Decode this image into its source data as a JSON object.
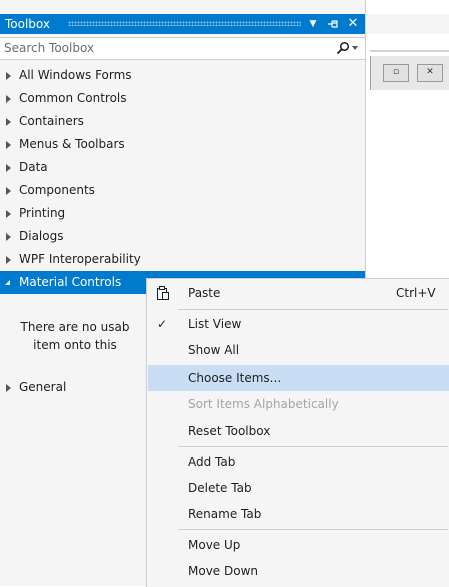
{
  "toolbox": {
    "title": "Toolbox",
    "search_placeholder": "Search Toolbox",
    "categories": [
      {
        "label": "All Windows Forms"
      },
      {
        "label": "Common Controls"
      },
      {
        "label": "Containers"
      },
      {
        "label": "Menus & Toolbars"
      },
      {
        "label": "Data"
      },
      {
        "label": "Components"
      },
      {
        "label": "Printing"
      },
      {
        "label": "Dialogs"
      },
      {
        "label": "WPF Interoperability"
      },
      {
        "label": "Material Controls"
      }
    ],
    "empty_message_line1": "There are no usab",
    "empty_message_line2": "item onto this",
    "general_label": "General"
  },
  "designer": {
    "restore_glyph": "▫",
    "close_glyph": "✕"
  },
  "context_menu": {
    "items": [
      {
        "label": "Paste",
        "shortcut": "Ctrl+V",
        "icon": "paste-icon"
      },
      {
        "label": "List View",
        "checked": true
      },
      {
        "label": "Show All"
      },
      {
        "label": "Choose Items...",
        "highlighted": true
      },
      {
        "label": "Sort Items Alphabetically",
        "disabled": true
      },
      {
        "label": "Reset Toolbox"
      },
      {
        "label": "Add Tab"
      },
      {
        "label": "Delete Tab"
      },
      {
        "label": "Rename Tab"
      },
      {
        "label": "Move Up"
      },
      {
        "label": "Move Down"
      }
    ],
    "check_glyph": "✓"
  },
  "colors": {
    "accent": "#007acc",
    "hover": "#c9def5",
    "panel": "#f5f5f5",
    "disabled_text": "#a2a4a5"
  }
}
